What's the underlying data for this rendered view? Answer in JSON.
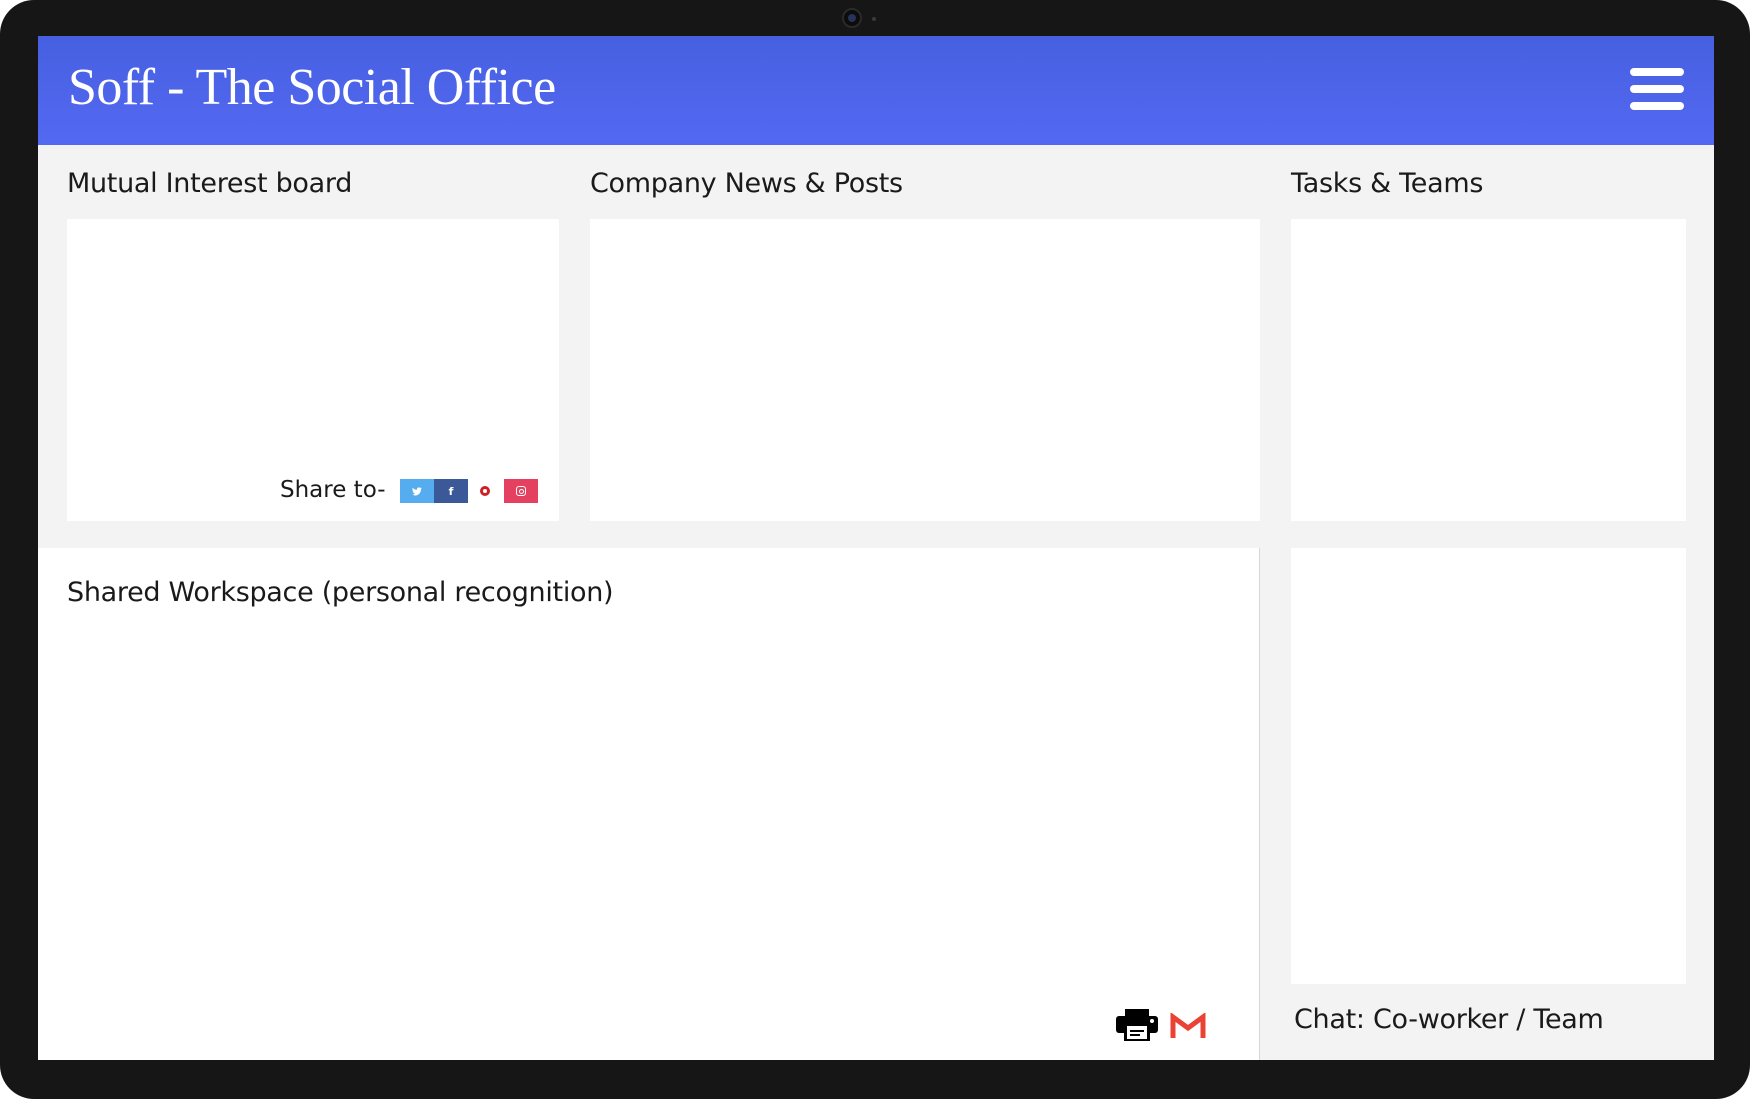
{
  "header": {
    "app_title": "Soff - The Social Office",
    "menu_icon": "hamburger-menu-icon"
  },
  "sections": {
    "mutual_interest": {
      "title": "Mutual Interest board"
    },
    "company_news": {
      "title": "Company News & Posts"
    },
    "tasks_teams": {
      "title": "Tasks & Teams"
    },
    "shared_workspace": {
      "title": "Shared Workspace (personal recognition)"
    },
    "chat": {
      "title": "Chat: Co-worker / Team"
    }
  },
  "share": {
    "label": "Share to-",
    "buttons": [
      {
        "name": "twitter",
        "icon": "twitter-icon",
        "color": "#55acee"
      },
      {
        "name": "facebook",
        "icon": "facebook-icon",
        "color": "#3b5998"
      },
      {
        "name": "pinterest",
        "icon": "pinterest-icon",
        "color": "#cb2027"
      },
      {
        "name": "instagram",
        "icon": "instagram-icon",
        "color": "#e4405f"
      }
    ]
  },
  "workspace_actions": [
    {
      "name": "print",
      "icon": "printer-icon"
    },
    {
      "name": "gmail",
      "icon": "gmail-icon",
      "color": "#ea4335"
    }
  ],
  "colors": {
    "header": "#4f66ee",
    "background": "#f3f3f3",
    "card": "#ffffff",
    "bezel": "#161616"
  }
}
